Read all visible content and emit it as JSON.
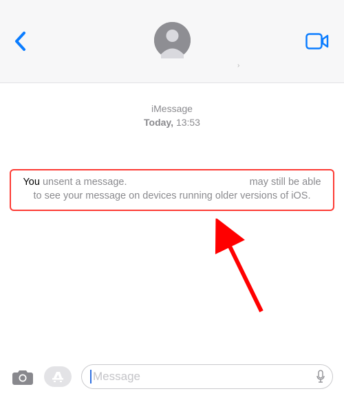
{
  "header": {
    "back_icon": "back-chevron",
    "avatar": "generic-avatar",
    "video_icon": "video-camera"
  },
  "timestamp": {
    "line1": "iMessage",
    "day": "Today,",
    "time": "13:53"
  },
  "unsent": {
    "you": "You",
    "rest1": " unsent a message.",
    "rest2": "may still be able to see your message on devices running older versions of iOS."
  },
  "input": {
    "placeholder": "Message"
  },
  "colors": {
    "ios_blue": "#0a7cff",
    "highlight_red": "#fd3a33"
  }
}
